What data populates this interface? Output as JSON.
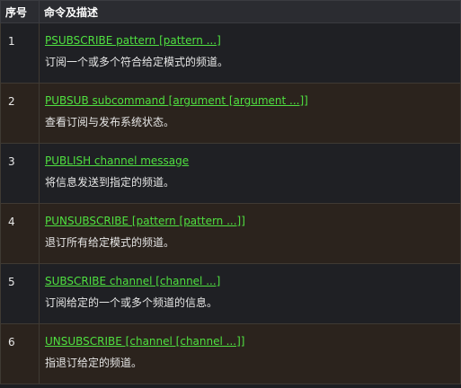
{
  "colors": {
    "header_bg": "#2b2c31",
    "row_odd_bg": "#1f2024",
    "row_even_bg": "#2b231d",
    "link": "#4fe040",
    "text": "#e8e8e8"
  },
  "table": {
    "headers": {
      "num": "序号",
      "cmd": "命令及描述"
    },
    "rows": [
      {
        "num": "1",
        "cmd": "PSUBSCRIBE pattern [pattern ...]",
        "desc": "订阅一个或多个符合给定模式的频道。"
      },
      {
        "num": "2",
        "cmd": "PUBSUB subcommand [argument [argument ...]]",
        "desc": "查看订阅与发布系统状态。"
      },
      {
        "num": "3",
        "cmd": "PUBLISH channel message",
        "desc": "将信息发送到指定的频道。"
      },
      {
        "num": "4",
        "cmd": "PUNSUBSCRIBE [pattern [pattern ...]]",
        "desc": "退订所有给定模式的频道。"
      },
      {
        "num": "5",
        "cmd": "SUBSCRIBE channel [channel ...]",
        "desc": "订阅给定的一个或多个频道的信息。"
      },
      {
        "num": "6",
        "cmd": "UNSUBSCRIBE [channel [channel ...]]",
        "desc": "指退订给定的频道。"
      }
    ]
  }
}
